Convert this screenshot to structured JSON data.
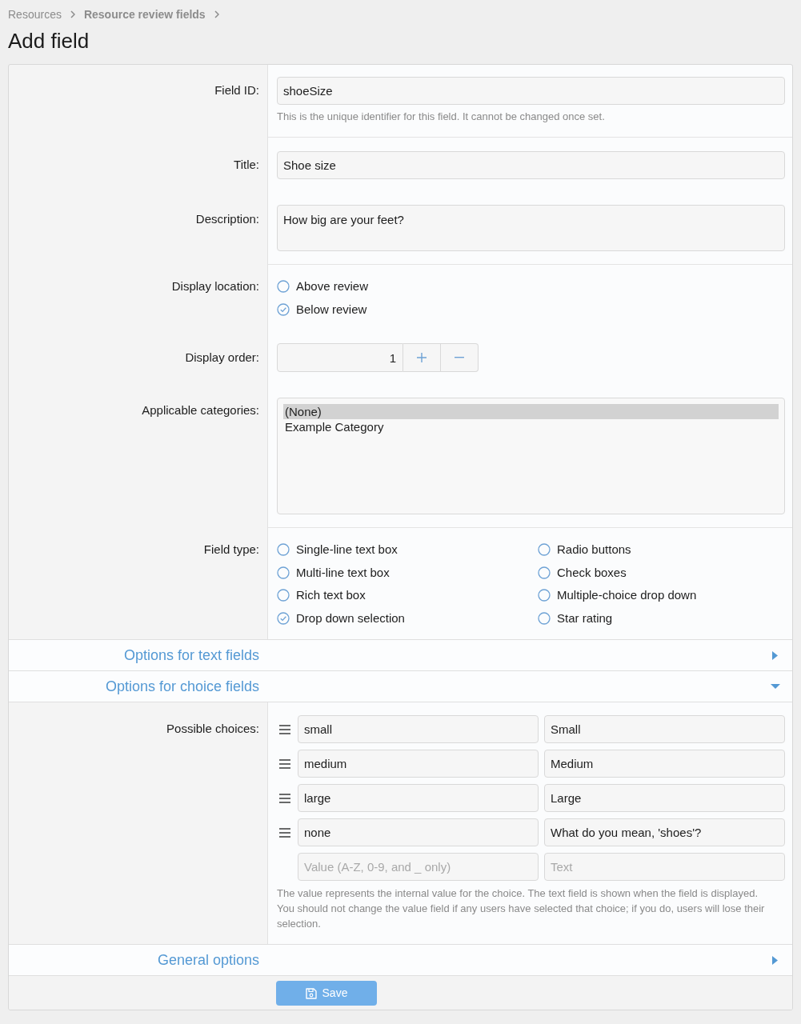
{
  "breadcrumb": [
    {
      "label": "Resources"
    },
    {
      "label": "Resource review fields"
    }
  ],
  "page_title": "Add field",
  "sections": [
    {
      "rows": [
        {
          "kind": "text",
          "label": "Field ID:",
          "value": "shoeSize",
          "hint": "This is the unique identifier for this field. It cannot be changed once set."
        }
      ]
    },
    {
      "rows": [
        {
          "kind": "text",
          "label": "Title:",
          "value": "Shoe size"
        },
        {
          "kind": "textarea",
          "label": "Description:",
          "value": "How big are your feet?"
        }
      ]
    },
    {
      "rows": [
        {
          "kind": "radio",
          "label": "Display location:",
          "options": [
            {
              "label": "Above review",
              "selected": false
            },
            {
              "label": "Below review",
              "selected": true
            }
          ]
        },
        {
          "kind": "number",
          "label": "Display order:",
          "value": "1"
        },
        {
          "kind": "listbox",
          "label": "Applicable categories:",
          "options": [
            {
              "label": "(None)",
              "selected": true
            },
            {
              "label": "Example Category",
              "selected": false
            }
          ]
        }
      ]
    },
    {
      "rows": [
        {
          "kind": "grid",
          "label": "Field type:",
          "options": [
            {
              "label": "Single-line text box",
              "selected": false
            },
            {
              "label": "Multi-line text box",
              "selected": false
            },
            {
              "label": "Rich text box",
              "selected": false
            },
            {
              "label": "Drop down selection",
              "selected": true
            },
            {
              "label": "Radio buttons",
              "selected": false
            },
            {
              "label": "Check boxes",
              "selected": false
            },
            {
              "label": "Multiple-choice drop down",
              "selected": false
            },
            {
              "label": "Star rating",
              "selected": false
            }
          ]
        }
      ]
    }
  ],
  "panels": [
    {
      "title": "Options for text fields",
      "expanded": false
    },
    {
      "title": "Options for choice fields",
      "expanded": true,
      "rows": [
        {
          "kind": "choices",
          "label": "Possible choices:",
          "choices": [
            {
              "value": "small",
              "text": "Small"
            },
            {
              "value": "medium",
              "text": "Medium"
            },
            {
              "value": "large",
              "text": "Large"
            },
            {
              "value": "none",
              "text": "What do you mean, 'shoes'?"
            }
          ],
          "new_choice": {
            "value_placeholder": "Value (A-Z, 0-9, and _ only)",
            "text_placeholder": "Text"
          },
          "hint": "The value represents the internal value for the choice. The text field is shown when the field is displayed. You should not change the value field if any users have selected that choice; if you do, users will lose their selection."
        }
      ]
    },
    {
      "title": "General options",
      "expanded": false
    }
  ],
  "save_button": {
    "label": "Save"
  }
}
